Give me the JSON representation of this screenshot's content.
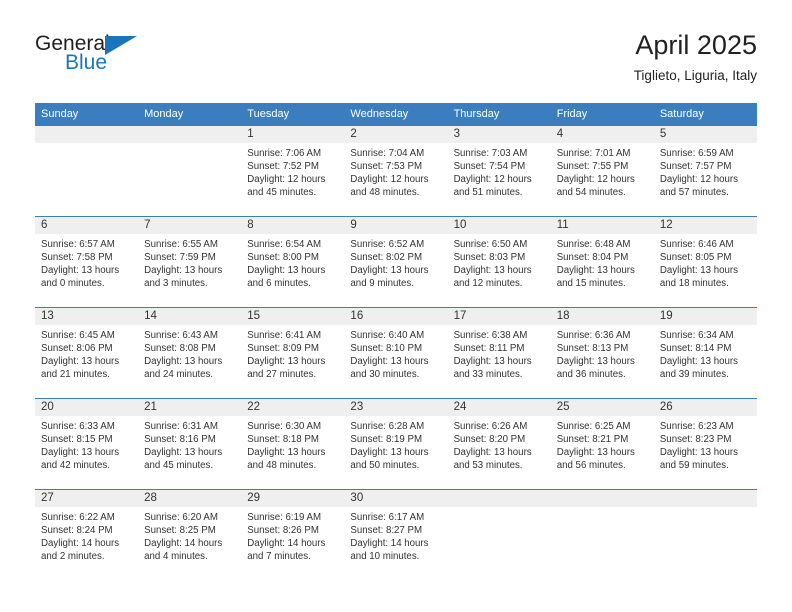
{
  "brand": {
    "name_part1": "General",
    "name_part2": "Blue",
    "triangle_icon": "triangle-icon",
    "accent_color": "#1b75bb"
  },
  "header": {
    "title": "April 2025",
    "subtitle": "Tiglieto, Liguria, Italy"
  },
  "colors": {
    "header_row_bg": "#3a7ebf",
    "daynum_bg": "#efefef",
    "text": "#333333"
  },
  "weekdays": [
    "Sunday",
    "Monday",
    "Tuesday",
    "Wednesday",
    "Thursday",
    "Friday",
    "Saturday"
  ],
  "weeks": [
    [
      {
        "day": "",
        "empty": true
      },
      {
        "day": "",
        "empty": true
      },
      {
        "day": "1",
        "sunrise": "Sunrise: 7:06 AM",
        "sunset": "Sunset: 7:52 PM",
        "daylight_line1": "Daylight: 12 hours",
        "daylight_line2": "and 45 minutes."
      },
      {
        "day": "2",
        "sunrise": "Sunrise: 7:04 AM",
        "sunset": "Sunset: 7:53 PM",
        "daylight_line1": "Daylight: 12 hours",
        "daylight_line2": "and 48 minutes."
      },
      {
        "day": "3",
        "sunrise": "Sunrise: 7:03 AM",
        "sunset": "Sunset: 7:54 PM",
        "daylight_line1": "Daylight: 12 hours",
        "daylight_line2": "and 51 minutes."
      },
      {
        "day": "4",
        "sunrise": "Sunrise: 7:01 AM",
        "sunset": "Sunset: 7:55 PM",
        "daylight_line1": "Daylight: 12 hours",
        "daylight_line2": "and 54 minutes."
      },
      {
        "day": "5",
        "sunrise": "Sunrise: 6:59 AM",
        "sunset": "Sunset: 7:57 PM",
        "daylight_line1": "Daylight: 12 hours",
        "daylight_line2": "and 57 minutes."
      }
    ],
    [
      {
        "day": "6",
        "sunrise": "Sunrise: 6:57 AM",
        "sunset": "Sunset: 7:58 PM",
        "daylight_line1": "Daylight: 13 hours",
        "daylight_line2": "and 0 minutes."
      },
      {
        "day": "7",
        "sunrise": "Sunrise: 6:55 AM",
        "sunset": "Sunset: 7:59 PM",
        "daylight_line1": "Daylight: 13 hours",
        "daylight_line2": "and 3 minutes."
      },
      {
        "day": "8",
        "sunrise": "Sunrise: 6:54 AM",
        "sunset": "Sunset: 8:00 PM",
        "daylight_line1": "Daylight: 13 hours",
        "daylight_line2": "and 6 minutes."
      },
      {
        "day": "9",
        "sunrise": "Sunrise: 6:52 AM",
        "sunset": "Sunset: 8:02 PM",
        "daylight_line1": "Daylight: 13 hours",
        "daylight_line2": "and 9 minutes."
      },
      {
        "day": "10",
        "sunrise": "Sunrise: 6:50 AM",
        "sunset": "Sunset: 8:03 PM",
        "daylight_line1": "Daylight: 13 hours",
        "daylight_line2": "and 12 minutes."
      },
      {
        "day": "11",
        "sunrise": "Sunrise: 6:48 AM",
        "sunset": "Sunset: 8:04 PM",
        "daylight_line1": "Daylight: 13 hours",
        "daylight_line2": "and 15 minutes."
      },
      {
        "day": "12",
        "sunrise": "Sunrise: 6:46 AM",
        "sunset": "Sunset: 8:05 PM",
        "daylight_line1": "Daylight: 13 hours",
        "daylight_line2": "and 18 minutes."
      }
    ],
    [
      {
        "day": "13",
        "sunrise": "Sunrise: 6:45 AM",
        "sunset": "Sunset: 8:06 PM",
        "daylight_line1": "Daylight: 13 hours",
        "daylight_line2": "and 21 minutes."
      },
      {
        "day": "14",
        "sunrise": "Sunrise: 6:43 AM",
        "sunset": "Sunset: 8:08 PM",
        "daylight_line1": "Daylight: 13 hours",
        "daylight_line2": "and 24 minutes."
      },
      {
        "day": "15",
        "sunrise": "Sunrise: 6:41 AM",
        "sunset": "Sunset: 8:09 PM",
        "daylight_line1": "Daylight: 13 hours",
        "daylight_line2": "and 27 minutes."
      },
      {
        "day": "16",
        "sunrise": "Sunrise: 6:40 AM",
        "sunset": "Sunset: 8:10 PM",
        "daylight_line1": "Daylight: 13 hours",
        "daylight_line2": "and 30 minutes."
      },
      {
        "day": "17",
        "sunrise": "Sunrise: 6:38 AM",
        "sunset": "Sunset: 8:11 PM",
        "daylight_line1": "Daylight: 13 hours",
        "daylight_line2": "and 33 minutes."
      },
      {
        "day": "18",
        "sunrise": "Sunrise: 6:36 AM",
        "sunset": "Sunset: 8:13 PM",
        "daylight_line1": "Daylight: 13 hours",
        "daylight_line2": "and 36 minutes."
      },
      {
        "day": "19",
        "sunrise": "Sunrise: 6:34 AM",
        "sunset": "Sunset: 8:14 PM",
        "daylight_line1": "Daylight: 13 hours",
        "daylight_line2": "and 39 minutes."
      }
    ],
    [
      {
        "day": "20",
        "sunrise": "Sunrise: 6:33 AM",
        "sunset": "Sunset: 8:15 PM",
        "daylight_line1": "Daylight: 13 hours",
        "daylight_line2": "and 42 minutes."
      },
      {
        "day": "21",
        "sunrise": "Sunrise: 6:31 AM",
        "sunset": "Sunset: 8:16 PM",
        "daylight_line1": "Daylight: 13 hours",
        "daylight_line2": "and 45 minutes."
      },
      {
        "day": "22",
        "sunrise": "Sunrise: 6:30 AM",
        "sunset": "Sunset: 8:18 PM",
        "daylight_line1": "Daylight: 13 hours",
        "daylight_line2": "and 48 minutes."
      },
      {
        "day": "23",
        "sunrise": "Sunrise: 6:28 AM",
        "sunset": "Sunset: 8:19 PM",
        "daylight_line1": "Daylight: 13 hours",
        "daylight_line2": "and 50 minutes."
      },
      {
        "day": "24",
        "sunrise": "Sunrise: 6:26 AM",
        "sunset": "Sunset: 8:20 PM",
        "daylight_line1": "Daylight: 13 hours",
        "daylight_line2": "and 53 minutes."
      },
      {
        "day": "25",
        "sunrise": "Sunrise: 6:25 AM",
        "sunset": "Sunset: 8:21 PM",
        "daylight_line1": "Daylight: 13 hours",
        "daylight_line2": "and 56 minutes."
      },
      {
        "day": "26",
        "sunrise": "Sunrise: 6:23 AM",
        "sunset": "Sunset: 8:23 PM",
        "daylight_line1": "Daylight: 13 hours",
        "daylight_line2": "and 59 minutes."
      }
    ],
    [
      {
        "day": "27",
        "sunrise": "Sunrise: 6:22 AM",
        "sunset": "Sunset: 8:24 PM",
        "daylight_line1": "Daylight: 14 hours",
        "daylight_line2": "and 2 minutes."
      },
      {
        "day": "28",
        "sunrise": "Sunrise: 6:20 AM",
        "sunset": "Sunset: 8:25 PM",
        "daylight_line1": "Daylight: 14 hours",
        "daylight_line2": "and 4 minutes."
      },
      {
        "day": "29",
        "sunrise": "Sunrise: 6:19 AM",
        "sunset": "Sunset: 8:26 PM",
        "daylight_line1": "Daylight: 14 hours",
        "daylight_line2": "and 7 minutes."
      },
      {
        "day": "30",
        "sunrise": "Sunrise: 6:17 AM",
        "sunset": "Sunset: 8:27 PM",
        "daylight_line1": "Daylight: 14 hours",
        "daylight_line2": "and 10 minutes."
      },
      {
        "day": "",
        "empty": true
      },
      {
        "day": "",
        "empty": true
      },
      {
        "day": "",
        "empty": true
      }
    ]
  ]
}
